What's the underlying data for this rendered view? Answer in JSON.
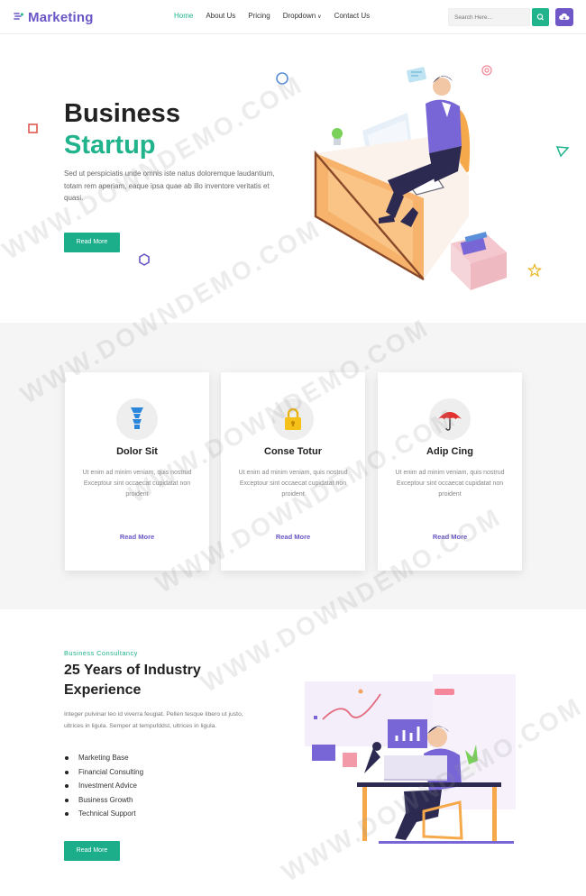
{
  "nav": {
    "logo": "Marketing",
    "items": [
      "Home",
      "About Us",
      "Pricing",
      "Dropdown",
      "Contact Us"
    ],
    "active_index": 0,
    "search_placeholder": "Search Here..."
  },
  "hero": {
    "title_line1": "Business",
    "title_line2": "Startup",
    "text": "Sed ut perspiciatis unde omnis iste natus doloremque laudantium, totam rem aperiam, eaque ipsa quae ab illo inventore veritatis et quasi.",
    "button": "Read More"
  },
  "features": [
    {
      "title": "Dolor Sit",
      "text": "Ut enim ad minim veniam, quis nostrud Exceptour sint occaecat cupidatat non proident",
      "link": "Read More",
      "icon": "lightbulb-icon"
    },
    {
      "title": "Conse Totur",
      "text": "Ut enim ad minim veniam, quis nostrud Exceptour sint occaecat cupidatat non proident",
      "link": "Read More",
      "icon": "padlock-icon"
    },
    {
      "title": "Adip Cing",
      "text": "Ut enim ad minim veniam, quis nostrud Exceptour sint occaecat cupidatat non proident",
      "link": "Read More",
      "icon": "umbrella-icon"
    }
  ],
  "about": {
    "subtitle": "Business Consultancy",
    "title": "25 Years of Industry Experience",
    "text": "Integer pulvinar leo id viverra feugiat. Pellen tesque libero ut justo, ultrices in ligula. Semper at tempufddst, ultrices in ligula.",
    "list": [
      "Marketing Base",
      "Financial Consulting",
      "Investment Advice",
      "Business Growth",
      "Technical Support"
    ],
    "button": "Read More"
  },
  "watermark": "WWW.DOWNDEMO.COM",
  "colors": {
    "brand": "#6a56c6",
    "accent": "#20b38c"
  }
}
